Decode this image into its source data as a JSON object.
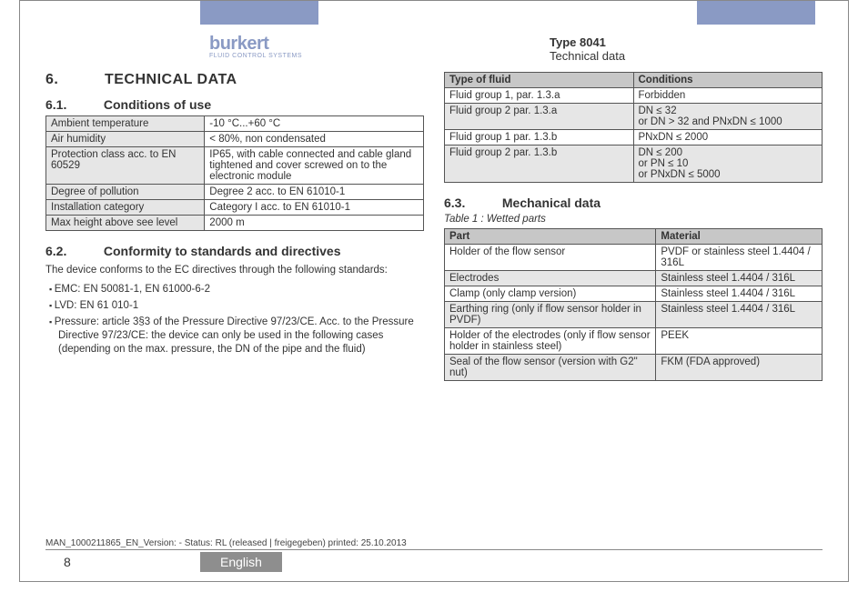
{
  "brand": {
    "name": "burkert",
    "tagline": "FLUID CONTROL SYSTEMS"
  },
  "docHeader": {
    "type": "Type 8041",
    "section": "Technical data"
  },
  "section6": {
    "num": "6.",
    "title": "TECHNICAL DATA"
  },
  "sub61": {
    "num": "6.1.",
    "title": "Conditions of use"
  },
  "conditionsTable": [
    [
      "Ambient temperature",
      "-10 °C...+60 °C"
    ],
    [
      "Air humidity",
      "< 80%, non condensated"
    ],
    [
      "Protection class acc. to EN 60529",
      "IP65, with cable connected and cable gland tightened and cover screwed on to the electronic module"
    ],
    [
      "Degree of pollution",
      "Degree 2 acc. to EN 61010-1"
    ],
    [
      "Installation category",
      "Category I acc. to EN 61010-1"
    ],
    [
      "Max height above see level",
      "2000 m"
    ]
  ],
  "sub62": {
    "num": "6.2.",
    "title": "Conformity to standards and directives"
  },
  "conformityIntro": "The device conforms to the EC directives through the following standards:",
  "conformityBullets": [
    "EMC: EN 50081-1, EN 61000-6-2",
    "LVD: EN 61 010-1",
    "Pressure: article 3§3 of the Pressure Directive 97/23/CE. Acc. to the Pressure Directive 97/23/CE: the device can only be used in the following cases (depending on the max. pressure, the DN of the pipe and the fluid)"
  ],
  "fluidTable": {
    "headers": [
      "Type of fluid",
      "Conditions"
    ],
    "rows": [
      {
        "shade": false,
        "cells": [
          "Fluid group 1, par. 1.3.a",
          "Forbidden"
        ]
      },
      {
        "shade": true,
        "cells": [
          "Fluid group 2 par. 1.3.a",
          "DN ≤ 32\nor DN > 32 and PNxDN ≤ 1000"
        ]
      },
      {
        "shade": false,
        "cells": [
          "Fluid group 1 par. 1.3.b",
          "PNxDN ≤ 2000"
        ]
      },
      {
        "shade": true,
        "cells": [
          "Fluid group 2 par. 1.3.b",
          "DN ≤ 200\nor PN ≤ 10\nor PNxDN ≤ 5000"
        ]
      }
    ]
  },
  "sub63": {
    "num": "6.3.",
    "title": "Mechanical data"
  },
  "tableCaption": "Table 1 :   Wetted parts",
  "wettedTable": {
    "headers": [
      "Part",
      "Material"
    ],
    "rows": [
      {
        "shade": false,
        "cells": [
          "Holder of the flow sensor",
          "PVDF or stainless steel 1.4404 / 316L"
        ]
      },
      {
        "shade": true,
        "cells": [
          "Electrodes",
          "Stainless steel 1.4404 / 316L"
        ]
      },
      {
        "shade": false,
        "cells": [
          "Clamp (only clamp version)",
          "Stainless steel 1.4404 / 316L"
        ]
      },
      {
        "shade": true,
        "cells": [
          "Earthing ring (only if flow sensor holder in PVDF)",
          "Stainless steel 1.4404 / 316L"
        ]
      },
      {
        "shade": false,
        "cells": [
          "Holder of the electrodes (only if flow sensor holder in stainless steel)",
          "PEEK"
        ]
      },
      {
        "shade": true,
        "cells": [
          "Seal of the flow sensor (version with G2\" nut)",
          "FKM (FDA approved)"
        ]
      }
    ]
  },
  "footerMeta": "MAN_1000211865_EN_Version: - Status: RL (released | freigegeben)  printed: 25.10.2013",
  "pageNumber": "8",
  "language": "English"
}
